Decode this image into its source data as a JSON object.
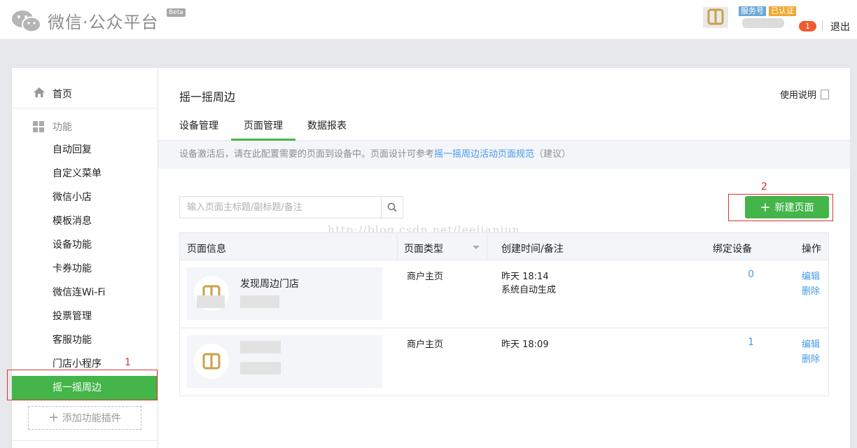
{
  "header": {
    "logo_text": "微信·公众平台",
    "beta": "Beta",
    "account_type_badge": "服务号",
    "verified_badge": "已认证",
    "notification_count": "1",
    "logout": "退出"
  },
  "sidebar": {
    "home": "首页",
    "section": "功能",
    "items": [
      {
        "label": "自动回复"
      },
      {
        "label": "自定义菜单"
      },
      {
        "label": "微信小店"
      },
      {
        "label": "模板消息"
      },
      {
        "label": "设备功能"
      },
      {
        "label": "卡券功能"
      },
      {
        "label": "微信连Wi-Fi"
      },
      {
        "label": "投票管理"
      },
      {
        "label": "客服功能"
      },
      {
        "label": "门店小程序"
      },
      {
        "label": "摇一摇周边"
      }
    ],
    "add_plugin": "添加功能插件"
  },
  "main": {
    "title": "摇一摇周边",
    "help": "使用说明",
    "tabs": [
      {
        "label": "设备管理"
      },
      {
        "label": "页面管理"
      },
      {
        "label": "数据报表"
      }
    ],
    "notice_prefix": "设备激活后，请在此配置需要的页面到设备中。页面设计可参考",
    "notice_link": "摇一摇周边活动页面规范",
    "notice_suffix": "（建议）",
    "search_placeholder": "输入页面主标题/副标题/备注",
    "new_page_button": "新建页面",
    "watermark": "http://blog.csdn.net/leejianjun",
    "annotations": {
      "one": "1",
      "two": "2"
    },
    "table": {
      "headers": {
        "info": "页面信息",
        "type": "页面类型",
        "created": "创建时间/备注",
        "devices": "绑定设备",
        "ops": "操作"
      },
      "rows": [
        {
          "title": "发现周边门店",
          "type": "商户主页",
          "time": "昨天 18:14",
          "note": "系统自动生成",
          "devices": "0",
          "edit": "编辑",
          "delete": "删除"
        },
        {
          "title": "",
          "type": "商户主页",
          "time": "昨天 18:09",
          "note": "",
          "devices": "1",
          "edit": "编辑",
          "delete": "删除"
        }
      ]
    }
  }
}
